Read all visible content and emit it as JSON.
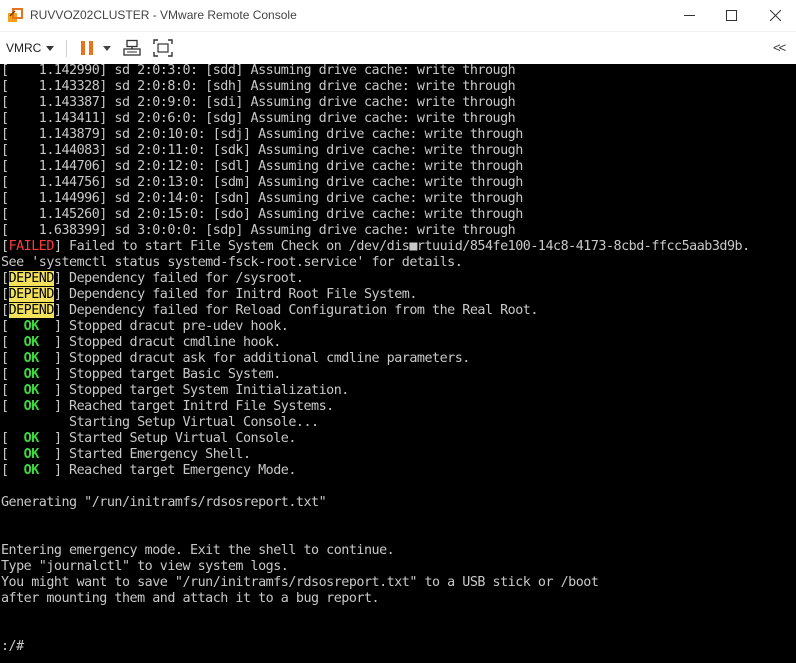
{
  "window": {
    "title": "RUVVOZ02CLUSTER - VMware Remote Console",
    "icons": {
      "app": "vmware-remote-console-icon",
      "minimize": "minimize-icon",
      "maximize": "maximize-icon",
      "close": "close-icon"
    }
  },
  "toolbar": {
    "menu_label": "VMRC",
    "pause_icon": "pause-icon",
    "send_keys_icon": "send-ctrl-alt-del-icon",
    "fullscreen_icon": "fullscreen-icon",
    "collapse_label": "<<",
    "accent_color": "#e8731e"
  },
  "console": {
    "colors": {
      "background": "#000000",
      "text": "#c8c8c8",
      "failed": "#ff3b3b",
      "ok": "#3ddc3d",
      "depend_bg": "#f3e15a"
    },
    "lines": [
      {
        "tag": null,
        "text": "[    1.142990] sd 2:0:3:0: [sdd] Assuming drive cache: write through"
      },
      {
        "tag": null,
        "text": "[    1.143328] sd 2:0:8:0: [sdh] Assuming drive cache: write through"
      },
      {
        "tag": null,
        "text": "[    1.143387] sd 2:0:9:0: [sdi] Assuming drive cache: write through"
      },
      {
        "tag": null,
        "text": "[    1.143411] sd 2:0:6:0: [sdg] Assuming drive cache: write through"
      },
      {
        "tag": null,
        "text": "[    1.143879] sd 2:0:10:0: [sdj] Assuming drive cache: write through"
      },
      {
        "tag": null,
        "text": "[    1.144083] sd 2:0:11:0: [sdk] Assuming drive cache: write through"
      },
      {
        "tag": null,
        "text": "[    1.144706] sd 2:0:12:0: [sdl] Assuming drive cache: write through"
      },
      {
        "tag": null,
        "text": "[    1.144756] sd 2:0:13:0: [sdm] Assuming drive cache: write through"
      },
      {
        "tag": null,
        "text": "[    1.144996] sd 2:0:14:0: [sdn] Assuming drive cache: write through"
      },
      {
        "tag": null,
        "text": "[    1.145260] sd 2:0:15:0: [sdo] Assuming drive cache: write through"
      },
      {
        "tag": null,
        "text": "[    1.638399] sd 3:0:0:0: [sdp] Assuming drive cache: write through"
      },
      {
        "tag": "FAILED",
        "style": "failed",
        "text": " Failed to start File System Check on /dev/dis■rtuuid/854fe100-14c8-4173-8cbd-ffcc5aab3d9b."
      },
      {
        "tag": null,
        "text": "See 'systemctl status systemd-fsck-root.service' for details."
      },
      {
        "tag": "DEPEND",
        "style": "depend",
        "text": " Dependency failed for /sysroot."
      },
      {
        "tag": "DEPEND",
        "style": "depend",
        "text": " Dependency failed for Initrd Root File System."
      },
      {
        "tag": "DEPEND",
        "style": "depend",
        "text": " Dependency failed for Reload Configuration from the Real Root."
      },
      {
        "tag": "  OK  ",
        "style": "ok",
        "text": " Stopped dracut pre-udev hook."
      },
      {
        "tag": "  OK  ",
        "style": "ok",
        "text": " Stopped dracut cmdline hook."
      },
      {
        "tag": "  OK  ",
        "style": "ok",
        "text": " Stopped dracut ask for additional cmdline parameters."
      },
      {
        "tag": "  OK  ",
        "style": "ok",
        "text": " Stopped target Basic System."
      },
      {
        "tag": "  OK  ",
        "style": "ok",
        "text": " Stopped target System Initialization."
      },
      {
        "tag": "  OK  ",
        "style": "ok",
        "text": " Reached target Initrd File Systems."
      },
      {
        "tag": null,
        "text": "         Starting Setup Virtual Console..."
      },
      {
        "tag": "  OK  ",
        "style": "ok",
        "text": " Started Setup Virtual Console."
      },
      {
        "tag": "  OK  ",
        "style": "ok",
        "text": " Started Emergency Shell."
      },
      {
        "tag": "  OK  ",
        "style": "ok",
        "text": " Reached target Emergency Mode."
      },
      {
        "tag": null,
        "text": ""
      },
      {
        "tag": null,
        "text": "Generating \"/run/initramfs/rdsosreport.txt\""
      },
      {
        "tag": null,
        "text": ""
      },
      {
        "tag": null,
        "text": ""
      },
      {
        "tag": null,
        "text": "Entering emergency mode. Exit the shell to continue."
      },
      {
        "tag": null,
        "text": "Type \"journalctl\" to view system logs."
      },
      {
        "tag": null,
        "text": "You might want to save \"/run/initramfs/rdsosreport.txt\" to a USB stick or /boot"
      },
      {
        "tag": null,
        "text": "after mounting them and attach it to a bug report."
      },
      {
        "tag": null,
        "text": ""
      },
      {
        "tag": null,
        "text": ""
      },
      {
        "tag": null,
        "text": ":/#"
      }
    ]
  }
}
